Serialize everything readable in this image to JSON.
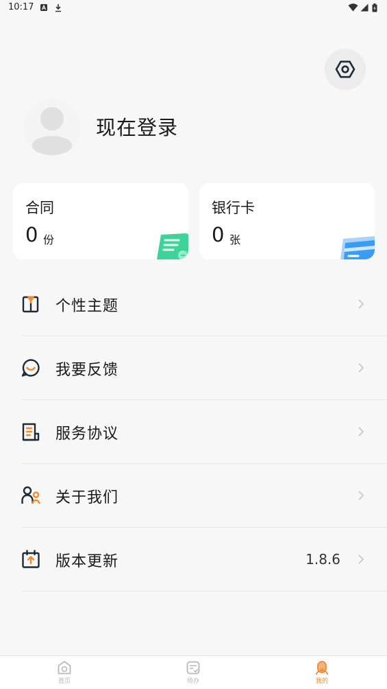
{
  "status_bar": {
    "time": "10:17",
    "left_icons": [
      "app-a-icon",
      "download-icon"
    ],
    "right_icons": [
      "wifi-icon",
      "signal-icon",
      "battery-icon"
    ]
  },
  "header": {
    "settings_icon": "hexagon-settings-icon"
  },
  "profile": {
    "login_text": "现在登录",
    "avatar_icon": "default-avatar-icon"
  },
  "cards": [
    {
      "title": "合同",
      "count": "0",
      "unit": "份",
      "icon": "contract-doc-icon",
      "accent": "#3ed39a"
    },
    {
      "title": "银行卡",
      "count": "0",
      "unit": "张",
      "icon": "bank-card-icon",
      "accent": "#3a9cf5"
    }
  ],
  "menu": [
    {
      "label": "个性主题",
      "icon": "theme-icon",
      "value": ""
    },
    {
      "label": "我要反馈",
      "icon": "feedback-icon",
      "value": ""
    },
    {
      "label": "服务协议",
      "icon": "agreement-icon",
      "value": ""
    },
    {
      "label": "关于我们",
      "icon": "about-us-icon",
      "value": ""
    },
    {
      "label": "版本更新",
      "icon": "update-icon",
      "value": "1.8.6"
    }
  ],
  "bottom_nav": [
    {
      "label": "首页",
      "icon": "home-icon",
      "active": false
    },
    {
      "label": "待办",
      "icon": "todo-icon",
      "active": false
    },
    {
      "label": "我的",
      "icon": "profile-icon",
      "active": true
    }
  ],
  "colors": {
    "accent": "#f28a2e",
    "icon_dark": "#1f2a37",
    "background": "#f7f7f7"
  }
}
